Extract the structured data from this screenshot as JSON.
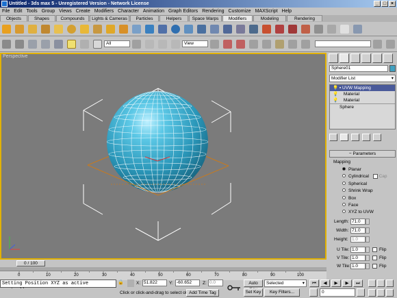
{
  "window": {
    "title": "Untitled - 3ds max 5 - Unregistered Version - Network License"
  },
  "menu": [
    "File",
    "Edit",
    "Tools",
    "Group",
    "Views",
    "Create",
    "Modifiers",
    "Character",
    "Animation",
    "Graph Editors",
    "Rendering",
    "Customize",
    "MAXScript",
    "Help"
  ],
  "tabs": [
    {
      "label": "Objects",
      "w": 40
    },
    {
      "label": "Shapes",
      "w": 40
    },
    {
      "label": "Compounds",
      "w": 48
    },
    {
      "label": "Lights & Cameras",
      "w": 58
    },
    {
      "label": "Particles",
      "w": 42
    },
    {
      "label": "Helpers",
      "w": 42
    },
    {
      "label": "Space Warps",
      "w": 48
    },
    {
      "label": "Modifiers",
      "w": 44,
      "selected": true
    },
    {
      "label": "Modeling",
      "w": 48
    },
    {
      "label": "Rendering",
      "w": 52
    }
  ],
  "toolbar": {
    "selection_filter": "All",
    "ref_coord": "View"
  },
  "viewport": {
    "label": "Perspective"
  },
  "command_panel": {
    "object_name": "Sphere01",
    "modifier_list": "Modifier List",
    "stack": [
      "UVW Mapping",
      "Material",
      "Material",
      "Sphere"
    ],
    "rollout_title": "Parameters",
    "mapping_label": "Mapping",
    "mapping_options": [
      "Planar",
      "Cylindrical",
      "Spherical",
      "Shrink Wrap",
      "Box",
      "Face",
      "XYZ to UVW"
    ],
    "mapping_selected": "Planar",
    "cap_label": "Cap",
    "length_label": "Length:",
    "length_value": "71.0",
    "width_label": "Width:",
    "width_value": "71.0",
    "height_label": "Height:",
    "height_value": "1.0",
    "utile_label": "U Tile:",
    "utile_value": "1.0",
    "vtile_label": "V Tile:",
    "vtile_value": "1.0",
    "wtile_label": "W Tile:",
    "wtile_value": "1.0",
    "flip_label": "Flip"
  },
  "timeline": {
    "frame_display": "0 / 100",
    "ticks": [
      "0",
      "10",
      "20",
      "30",
      "40",
      "50",
      "60",
      "70",
      "80",
      "90",
      "100"
    ]
  },
  "status": {
    "prompt": "Setting Position XYZ as active controller",
    "hint": "Click or click-and-drag to select ob",
    "x_label": "X:",
    "x_value": "51.822",
    "y_label": "Y:",
    "y_value": "-60.652",
    "z_label": "Z:",
    "z_value": "0.0",
    "add_time_tag": "Add Time Tag",
    "auto_key": "Auto Key",
    "set_key": "Set Key",
    "key_mode": "Selected",
    "key_filters": "Key Filters...",
    "frame": "0"
  },
  "colors": {
    "title_bar": "#0a246a",
    "viewport_bg": "#7b7b7b",
    "viewport_border": "#e2b100",
    "sphere": "#3aa8c6",
    "gizmo": "#c87a1e"
  }
}
